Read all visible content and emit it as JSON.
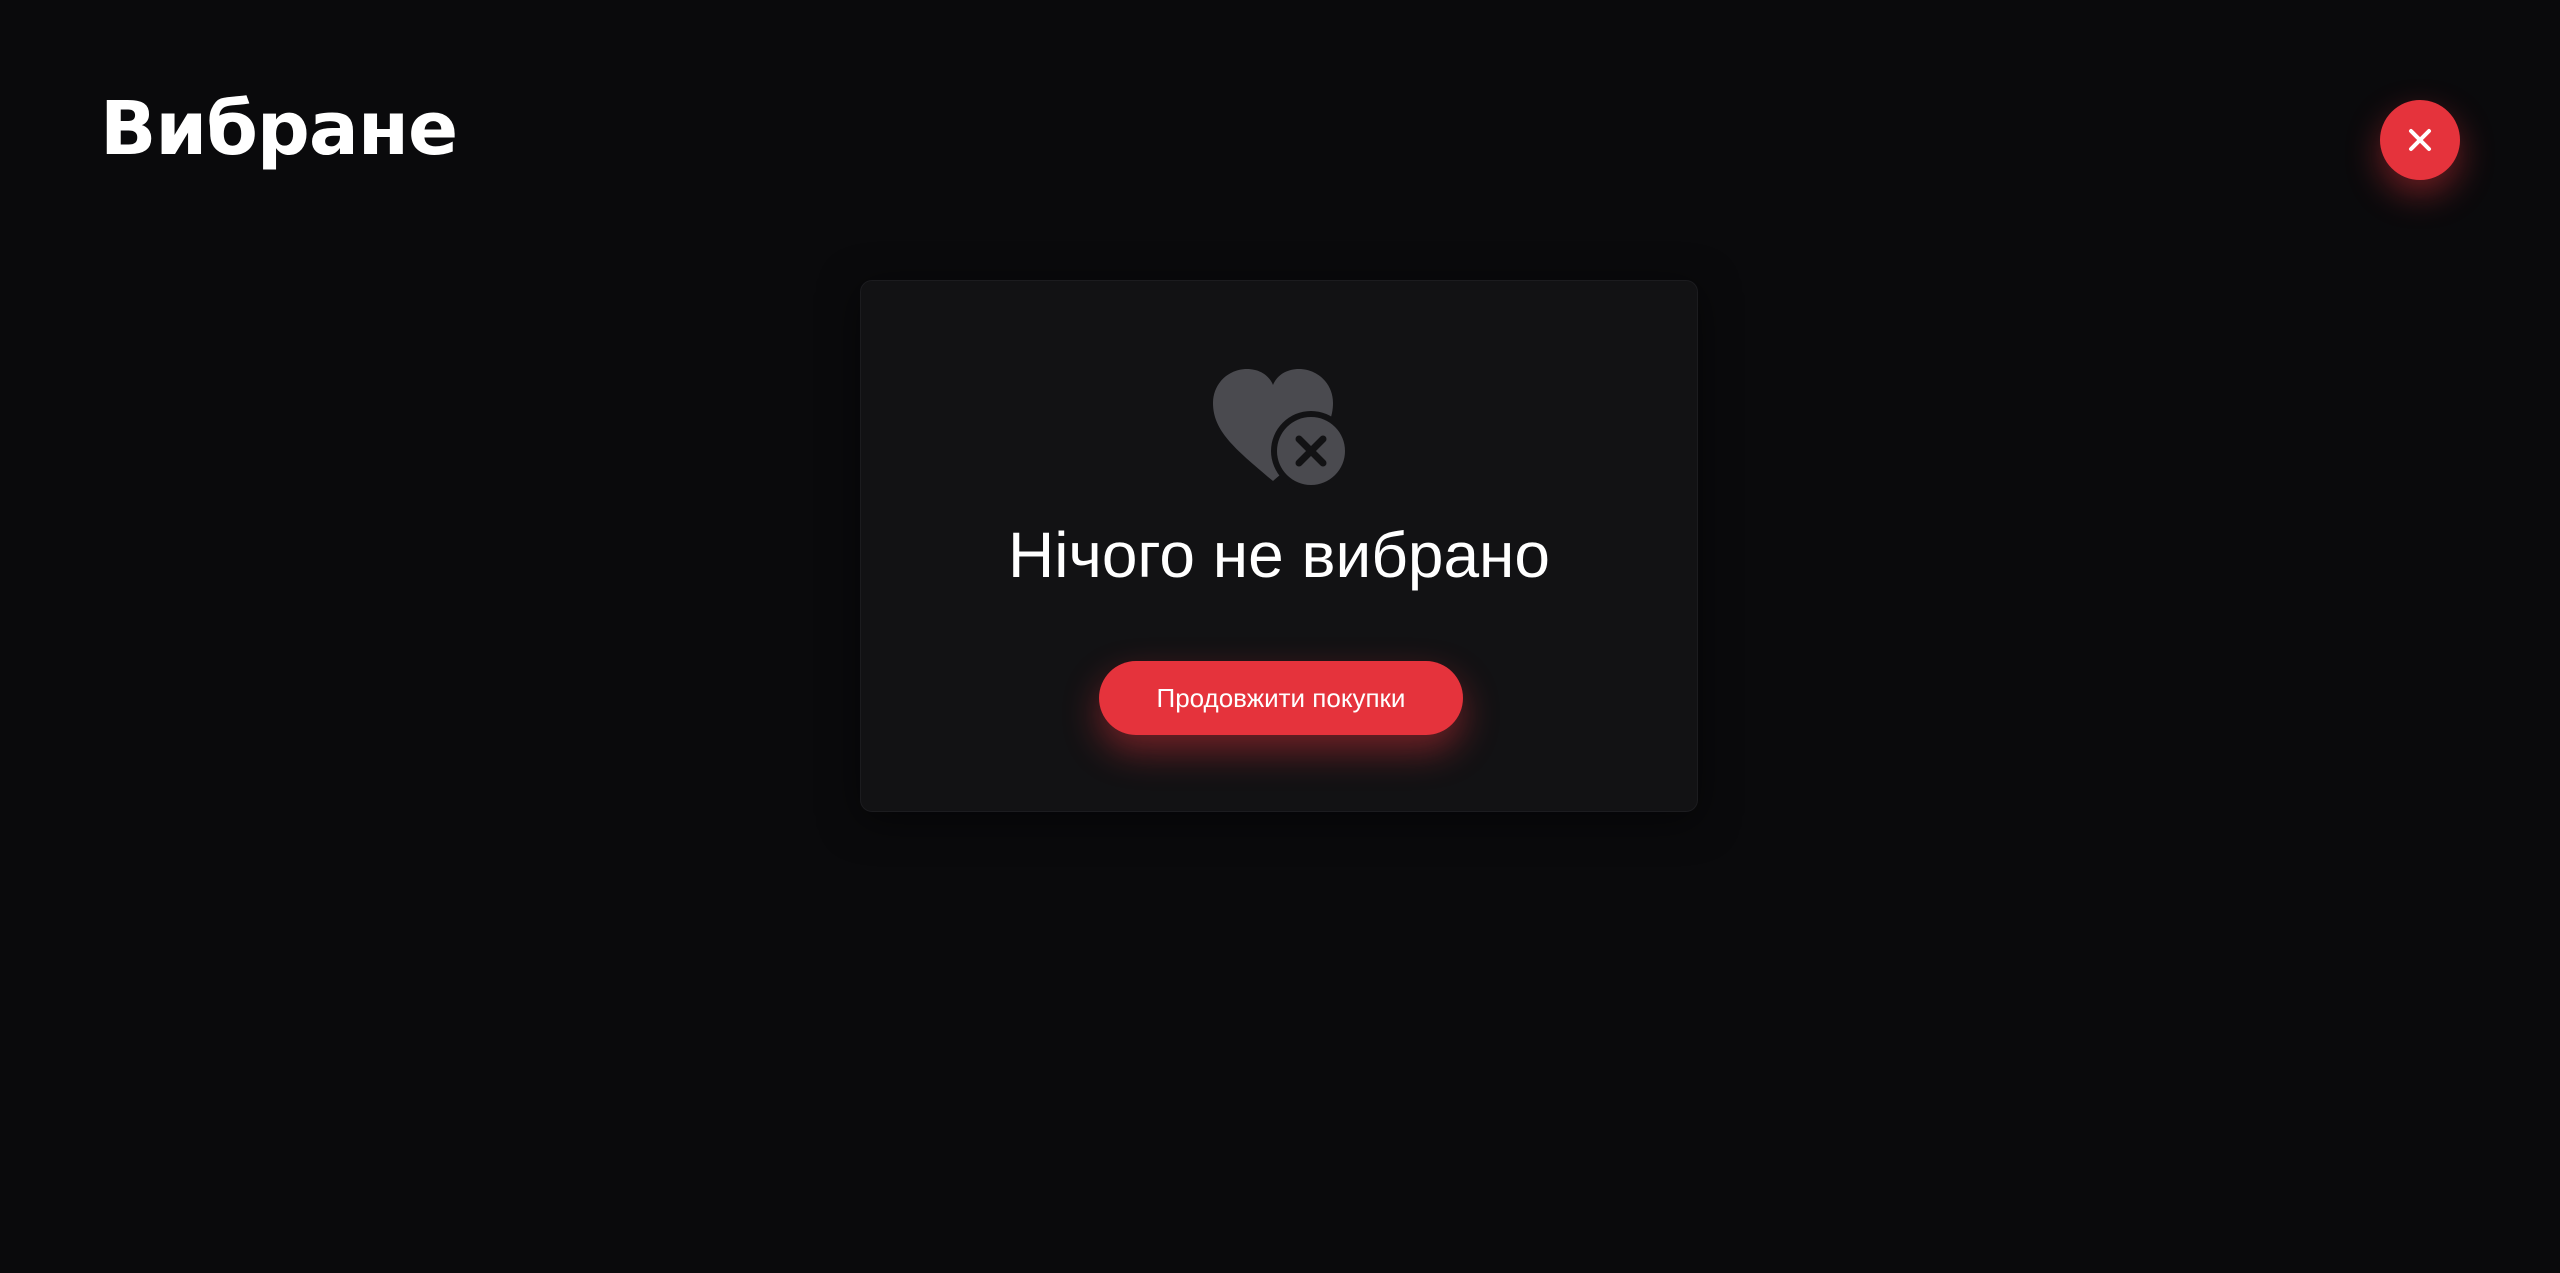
{
  "header": {
    "title": "Вибране",
    "close_icon": "close-icon"
  },
  "empty_state": {
    "icon": "heart-remove-icon",
    "message": "Нічого не вибрано",
    "button_label": "Продовжити покупки"
  },
  "colors": {
    "background": "#0a0a0c",
    "card": "#121214",
    "accent": "#e5333c",
    "icon_gray": "#4a4a4f",
    "text": "#ffffff"
  }
}
